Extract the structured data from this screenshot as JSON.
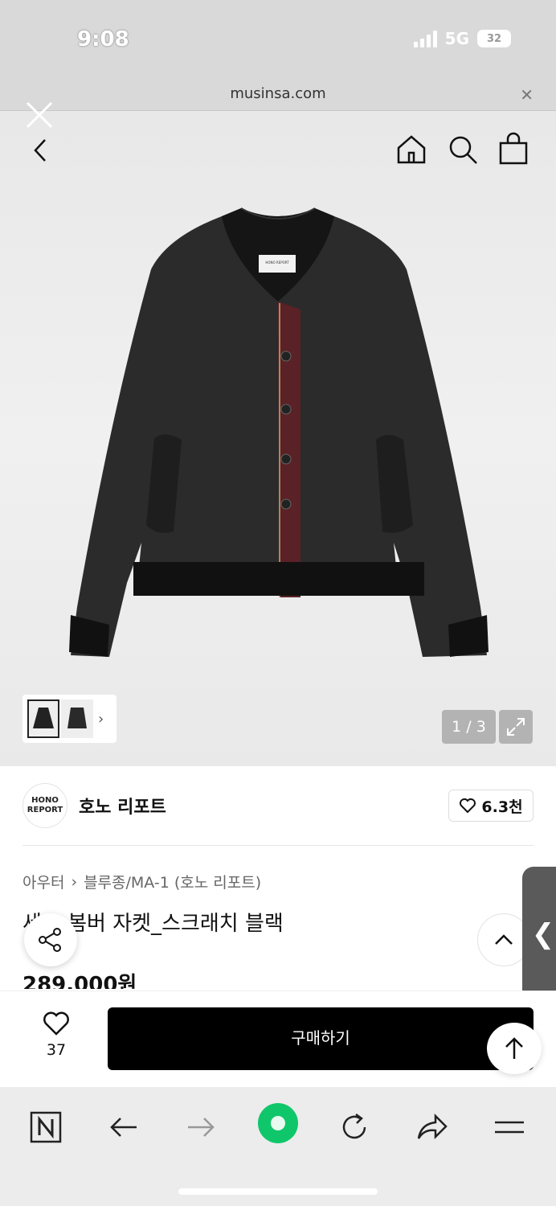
{
  "status": {
    "time": "9:08",
    "network": "5G",
    "battery": "32"
  },
  "browser": {
    "url": "musinsa.com"
  },
  "icons": {
    "close_overlay": "close-icon",
    "back": "chevron-left-icon",
    "home": "home-icon",
    "search": "search-icon",
    "bag": "shopping-bag-icon",
    "expand": "expand-icon",
    "heart": "heart-icon",
    "share": "share-icon",
    "chevron_up": "chevron-up-icon",
    "arrow_up": "arrow-up-icon"
  },
  "gallery": {
    "page_indicator": "1 / 3",
    "thumb_next": "›",
    "jacket_label": "HONO REPORT"
  },
  "brand": {
    "logo_line1": "HONO",
    "logo_line2": "REPORT",
    "name": "호노 리포트",
    "likes": "6.3천"
  },
  "breadcrumb": {
    "category": "아우터",
    "separator": "›",
    "subcategory": "블루종/MA-1 (호노 리포트)"
  },
  "product": {
    "title": "스티치 봄버 자켓_스크래치 블랙",
    "title_visible": "세트 봄버 자켓_스크래치 블랙",
    "price": "289,000원"
  },
  "purchase": {
    "wish_count": "37",
    "buy_label": "구매하기"
  },
  "side_tab": {
    "glyph": "❮"
  },
  "colors": {
    "accent_green": "#0fc76a",
    "buy_button": "#000000",
    "indicator_bg": "#b3b3b3"
  }
}
